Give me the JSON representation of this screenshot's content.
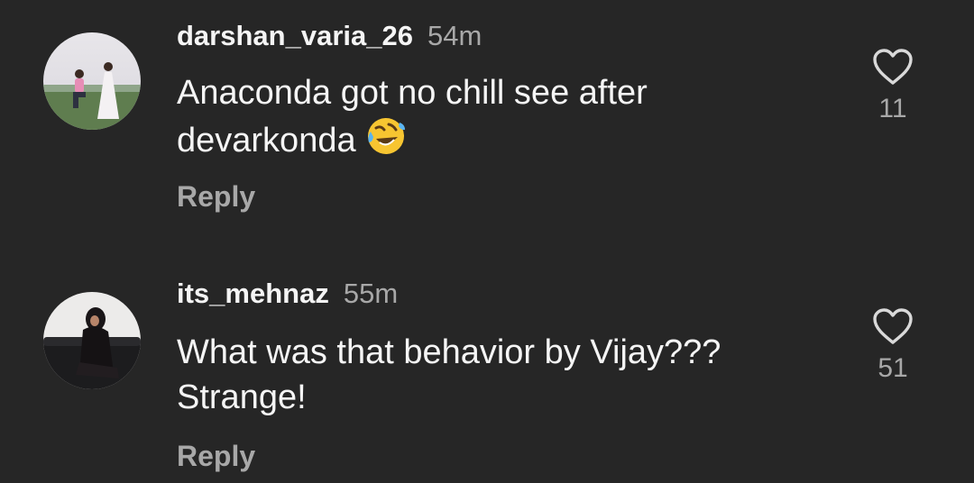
{
  "comments": [
    {
      "username": "darshan_varia_26",
      "time": "54m",
      "text_line1": "Anaconda got no chill see after",
      "text_line2": "devarkonda",
      "emoji": "rolling-on-floor-laughing-icon",
      "reply_label": "Reply",
      "likes": "11"
    },
    {
      "username": "its_mehnaz",
      "time": "55m",
      "text_line1": "What was that behavior by Vijay???",
      "text_line2": "Strange!",
      "reply_label": "Reply",
      "likes": "51"
    }
  ],
  "colors": {
    "background": "#262626",
    "primary_text": "#f5f5f5",
    "secondary_text": "#a8a8a8"
  }
}
